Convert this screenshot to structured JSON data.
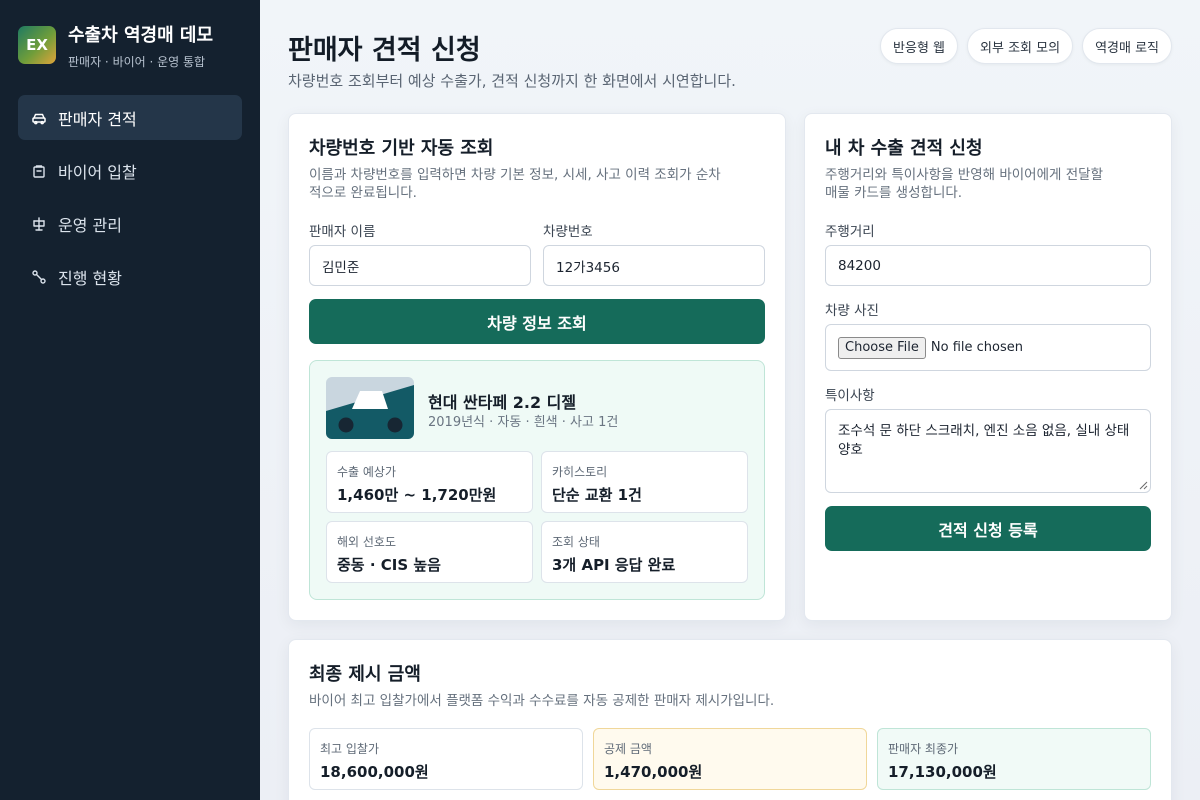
{
  "brand": {
    "logo": "EX",
    "title": "수출차 역경매 데모",
    "subtitle": "판매자 · 바이어 · 운영 통합"
  },
  "nav": [
    {
      "label": "판매자 견적",
      "icon": "car-icon",
      "active": true
    },
    {
      "label": "바이어 입찰",
      "icon": "bag-icon",
      "active": false
    },
    {
      "label": "운영 관리",
      "icon": "scale-icon",
      "active": false
    },
    {
      "label": "진행 현황",
      "icon": "route-icon",
      "active": false
    }
  ],
  "header": {
    "title": "판매자 견적 신청",
    "description": "차량번호 조회부터 예상 수출가, 견적 신청까지 한 화면에서 시연합니다.",
    "chips": [
      "반응형 웹",
      "외부 조회 모의",
      "역경매 로직"
    ]
  },
  "lookup": {
    "title": "차량번호 기반 자동 조회",
    "description_line1": "이름과 차량번호를 입력하면 차량 기본 정보, 시세, 사고 이력 조회가 순차",
    "description_line2": "적으로 완료됩니다.",
    "seller_label": "판매자 이름",
    "seller_value": "김민준",
    "plate_label": "차량번호",
    "plate_value": "12가3456",
    "button": "차량 정보 조회",
    "result": {
      "car_name": "현대 싼타페 2.2 디젤",
      "car_meta": "2019년식 · 자동 · 흰색 · 사고 1건",
      "stats": [
        {
          "label": "수출 예상가",
          "value": "1,460만 ~ 1,720만원"
        },
        {
          "label": "카히스토리",
          "value": "단순 교환 1건"
        },
        {
          "label": "해외 선호도",
          "value": "중동 · CIS 높음"
        },
        {
          "label": "조회 상태",
          "value": "3개 API 응답 완료"
        }
      ]
    }
  },
  "quote": {
    "title": "내 차 수출 견적 신청",
    "description_line1": "주행거리와 특이사항을 반영해 바이어에게 전달할",
    "description_line2": "매물 카드를 생성합니다.",
    "mileage_label": "주행거리",
    "mileage_value": "84200",
    "photo_label": "차량 사진",
    "photo_button": "Choose File",
    "photo_status": "No file chosen",
    "notes_label": "특이사항",
    "notes_value": "조수석 문 하단 스크래치, 엔진 소음 없음, 실내 상태 양호",
    "button": "견적 신청 등록"
  },
  "final": {
    "title": "최종 제시 금액",
    "description": "바이어 최고 입찰가에서 플랫폼 수익과 수수료를 자동 공제한 판매자 제시가입니다.",
    "boxes": [
      {
        "label": "최고 입찰가",
        "value": "18,600,000원"
      },
      {
        "label": "공제 금액",
        "value": "1,470,000원"
      },
      {
        "label": "판매자 최종가",
        "value": "17,130,000원"
      }
    ]
  },
  "colors": {
    "sidebar": "#14212f",
    "accent": "#156b5a",
    "result_bg": "#effaf6",
    "deduct_bg": "#fffaee"
  }
}
